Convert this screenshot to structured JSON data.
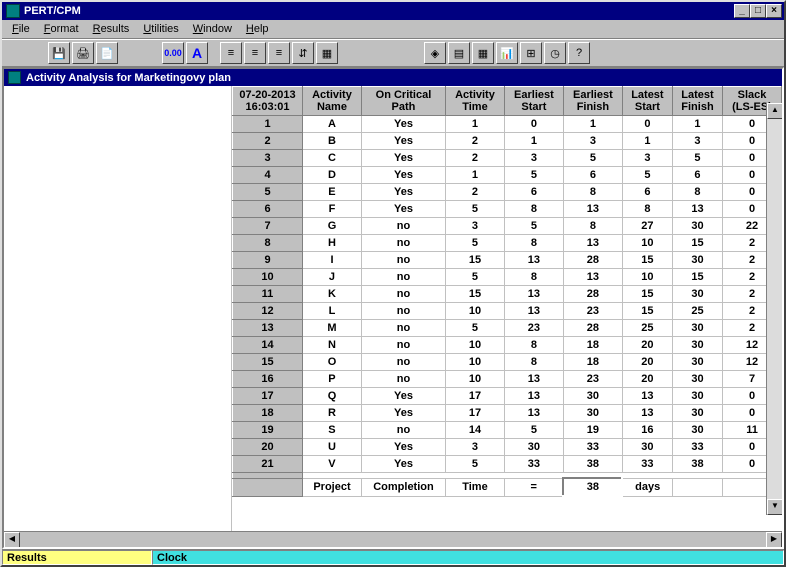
{
  "window": {
    "title": "PERT/CPM"
  },
  "menu": [
    "File",
    "Format",
    "Results",
    "Utilities",
    "Window",
    "Help"
  ],
  "toolbar": {
    "g1": [
      "save-icon",
      "print-icon",
      "print-preview-icon"
    ],
    "g2": [
      "decimal-icon",
      "font-icon"
    ],
    "g3": [
      "align-left-icon",
      "align-center-icon",
      "align-right-icon",
      "column-icon",
      "grid-icon"
    ],
    "g4": [
      "chart-diamond-icon",
      "gantt-icon",
      "table-green-icon",
      "bar-chart-icon",
      "calendar-icon",
      "clock-icon",
      "help-icon"
    ]
  },
  "toolbar_glyph": {
    "save-icon": "💾",
    "print-icon": "🖨",
    "print-preview-icon": "📄",
    "decimal-icon": "0.00",
    "font-icon": "A",
    "align-left-icon": "≡",
    "align-center-icon": "≡",
    "align-right-icon": "≡",
    "column-icon": "⇵",
    "grid-icon": "▦",
    "chart-diamond-icon": "◈",
    "gantt-icon": "▤",
    "table-green-icon": "▦",
    "bar-chart-icon": "📊",
    "calendar-icon": "⊞",
    "clock-icon": "◷",
    "help-icon": "?"
  },
  "child": {
    "title": "Activity Analysis for Marketingovy plan"
  },
  "headers": {
    "stamp_l1": "07-20-2013",
    "stamp_l2": "16:03:01",
    "c1_l1": "Activity",
    "c1_l2": "Name",
    "c2_l1": "On Critical",
    "c2_l2": "Path",
    "c3_l1": "Activity",
    "c3_l2": "Time",
    "c4_l1": "Earliest",
    "c4_l2": "Start",
    "c5_l1": "Earliest",
    "c5_l2": "Finish",
    "c6_l1": "Latest",
    "c6_l2": "Start",
    "c7_l1": "Latest",
    "c7_l2": "Finish",
    "c8_l1": "Slack",
    "c8_l2": "(LS-ES)"
  },
  "rows": [
    {
      "n": "1",
      "name": "A",
      "crit": "Yes",
      "time": "1",
      "es": "0",
      "ef": "1",
      "ls": "0",
      "lf": "1",
      "slack": "0"
    },
    {
      "n": "2",
      "name": "B",
      "crit": "Yes",
      "time": "2",
      "es": "1",
      "ef": "3",
      "ls": "1",
      "lf": "3",
      "slack": "0"
    },
    {
      "n": "3",
      "name": "C",
      "crit": "Yes",
      "time": "2",
      "es": "3",
      "ef": "5",
      "ls": "3",
      "lf": "5",
      "slack": "0"
    },
    {
      "n": "4",
      "name": "D",
      "crit": "Yes",
      "time": "1",
      "es": "5",
      "ef": "6",
      "ls": "5",
      "lf": "6",
      "slack": "0"
    },
    {
      "n": "5",
      "name": "E",
      "crit": "Yes",
      "time": "2",
      "es": "6",
      "ef": "8",
      "ls": "6",
      "lf": "8",
      "slack": "0"
    },
    {
      "n": "6",
      "name": "F",
      "crit": "Yes",
      "time": "5",
      "es": "8",
      "ef": "13",
      "ls": "8",
      "lf": "13",
      "slack": "0"
    },
    {
      "n": "7",
      "name": "G",
      "crit": "no",
      "time": "3",
      "es": "5",
      "ef": "8",
      "ls": "27",
      "lf": "30",
      "slack": "22"
    },
    {
      "n": "8",
      "name": "H",
      "crit": "no",
      "time": "5",
      "es": "8",
      "ef": "13",
      "ls": "10",
      "lf": "15",
      "slack": "2"
    },
    {
      "n": "9",
      "name": "I",
      "crit": "no",
      "time": "15",
      "es": "13",
      "ef": "28",
      "ls": "15",
      "lf": "30",
      "slack": "2"
    },
    {
      "n": "10",
      "name": "J",
      "crit": "no",
      "time": "5",
      "es": "8",
      "ef": "13",
      "ls": "10",
      "lf": "15",
      "slack": "2"
    },
    {
      "n": "11",
      "name": "K",
      "crit": "no",
      "time": "15",
      "es": "13",
      "ef": "28",
      "ls": "15",
      "lf": "30",
      "slack": "2"
    },
    {
      "n": "12",
      "name": "L",
      "crit": "no",
      "time": "10",
      "es": "13",
      "ef": "23",
      "ls": "15",
      "lf": "25",
      "slack": "2"
    },
    {
      "n": "13",
      "name": "M",
      "crit": "no",
      "time": "5",
      "es": "23",
      "ef": "28",
      "ls": "25",
      "lf": "30",
      "slack": "2"
    },
    {
      "n": "14",
      "name": "N",
      "crit": "no",
      "time": "10",
      "es": "8",
      "ef": "18",
      "ls": "20",
      "lf": "30",
      "slack": "12"
    },
    {
      "n": "15",
      "name": "O",
      "crit": "no",
      "time": "10",
      "es": "8",
      "ef": "18",
      "ls": "20",
      "lf": "30",
      "slack": "12"
    },
    {
      "n": "16",
      "name": "P",
      "crit": "no",
      "time": "10",
      "es": "13",
      "ef": "23",
      "ls": "20",
      "lf": "30",
      "slack": "7"
    },
    {
      "n": "17",
      "name": "Q",
      "crit": "Yes",
      "time": "17",
      "es": "13",
      "ef": "30",
      "ls": "13",
      "lf": "30",
      "slack": "0"
    },
    {
      "n": "18",
      "name": "R",
      "crit": "Yes",
      "time": "17",
      "es": "13",
      "ef": "30",
      "ls": "13",
      "lf": "30",
      "slack": "0"
    },
    {
      "n": "19",
      "name": "S",
      "crit": "no",
      "time": "14",
      "es": "5",
      "ef": "19",
      "ls": "16",
      "lf": "30",
      "slack": "11"
    },
    {
      "n": "20",
      "name": "U",
      "crit": "Yes",
      "time": "3",
      "es": "30",
      "ef": "33",
      "ls": "30",
      "lf": "33",
      "slack": "0"
    },
    {
      "n": "21",
      "name": "V",
      "crit": "Yes",
      "time": "5",
      "es": "33",
      "ef": "38",
      "ls": "33",
      "lf": "38",
      "slack": "0"
    }
  ],
  "footer": {
    "a": "Project",
    "b": "Completion",
    "c": "Time",
    "d": "=",
    "e": "38",
    "f": "days"
  },
  "status": {
    "results": "Results",
    "clock": "Clock"
  }
}
